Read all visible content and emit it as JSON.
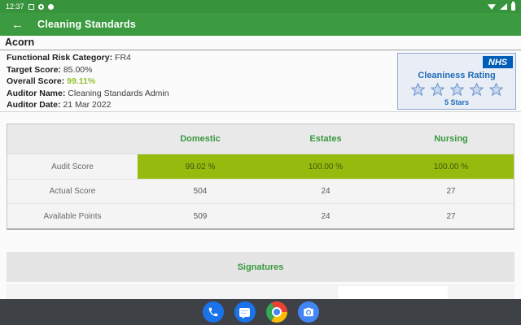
{
  "status_bar": {
    "time": "12:37"
  },
  "app_bar": {
    "back_icon": "←",
    "title": "Cleaning Standards"
  },
  "page": {
    "site_name": "Acorn"
  },
  "info": {
    "rows": [
      {
        "label": "Functional Risk Category:",
        "value": "FR4"
      },
      {
        "label": "Target Score:",
        "value": "85.00%"
      },
      {
        "label": "Overall Score:",
        "value": "99.11%"
      },
      {
        "label": "Auditor Name:",
        "value": "Cleaning Standards Admin"
      },
      {
        "label": "Auditor Date:",
        "value": "21 Mar 2022"
      }
    ]
  },
  "rating_card": {
    "logo": "NHS",
    "title": "Cleaniness Rating",
    "stars": 5,
    "stars_label": "5 Stars"
  },
  "results_table": {
    "columns": [
      "Domestic",
      "Estates",
      "Nursing"
    ],
    "rows": [
      {
        "label": "Audit Score",
        "values": [
          "99.02 %",
          "100.00 %",
          "100.00 %"
        ],
        "highlighted": true
      },
      {
        "label": "Actual Score",
        "values": [
          "504",
          "24",
          "27"
        ],
        "highlighted": false
      },
      {
        "label": "Available Points",
        "values": [
          "509",
          "24",
          "27"
        ],
        "highlighted": false
      }
    ]
  },
  "signatures": {
    "title": "Signatures"
  },
  "dock": {
    "icons": [
      "phone-icon",
      "messages-icon",
      "chrome-icon",
      "camera-icon"
    ]
  },
  "colors": {
    "primary_green": "#3c9a40",
    "score_green": "#93c232",
    "highlight_green": "#95bb0f",
    "nhs_blue": "#005eb8",
    "rating_blue": "#1f6cb9",
    "dock_bg": "#3e4145"
  }
}
